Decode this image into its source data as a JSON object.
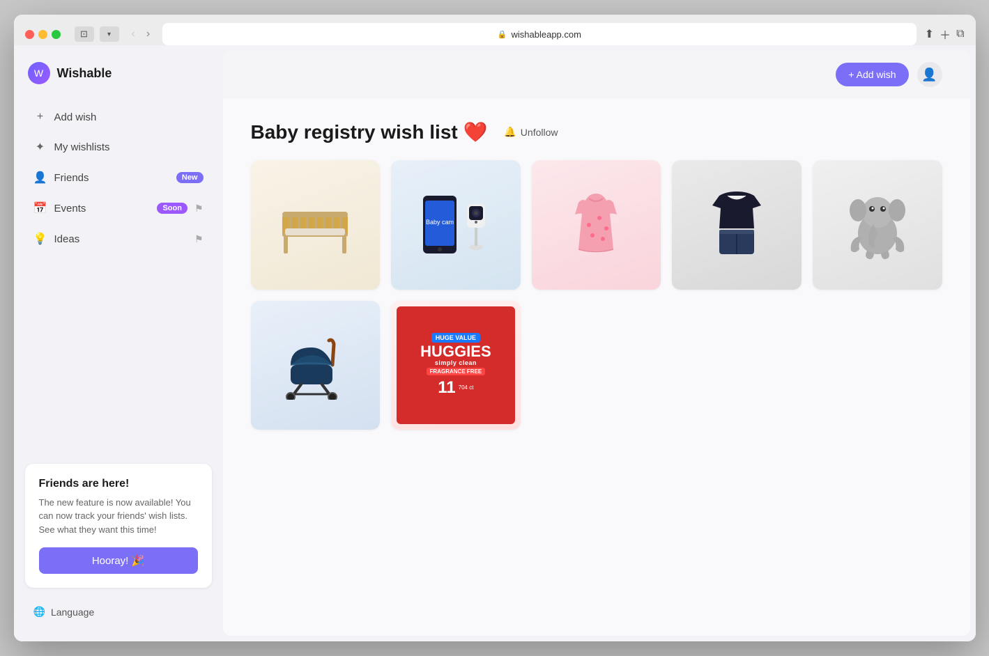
{
  "browser": {
    "url": "wishableapp.com",
    "tab_icon": "🔒"
  },
  "sidebar": {
    "logo_text": "Wishable",
    "nav_items": [
      {
        "id": "add-wish",
        "icon": "+",
        "label": "Add wish",
        "badge": null,
        "pinned": false
      },
      {
        "id": "my-wishlists",
        "icon": "✦",
        "label": "My wishlists",
        "badge": null,
        "pinned": false
      },
      {
        "id": "friends",
        "icon": "👤",
        "label": "Friends",
        "badge": "New",
        "badge_type": "new",
        "pinned": false
      },
      {
        "id": "events",
        "icon": "📅",
        "label": "Events",
        "badge": "Soon",
        "badge_type": "soon",
        "pinned": true
      },
      {
        "id": "ideas",
        "icon": "💡",
        "label": "Ideas",
        "badge": null,
        "pinned": true
      }
    ],
    "friends_card": {
      "title": "Friends are here!",
      "description": "The new feature is now available! You can now track your friends' wish lists. See what they want this time!",
      "button_label": "Hooray! 🎉"
    },
    "language_label": "Language"
  },
  "header": {
    "add_wish_label": "+ Add wish",
    "user_icon": "👤"
  },
  "main": {
    "page_title": "Baby registry wish list ❤️",
    "unfollow_label": "Unfollow",
    "products": [
      {
        "id": "crib",
        "emoji": "🛏️",
        "name": "Baby Crib",
        "color_from": "#f9f3e8",
        "color_to": "#f0e8d4"
      },
      {
        "id": "monitor",
        "emoji": "📱",
        "name": "Baby Monitor",
        "color_from": "#e8f0f9",
        "color_to": "#d4e4f0"
      },
      {
        "id": "dress",
        "emoji": "👗",
        "name": "Baby Dress",
        "color_from": "#fce8ec",
        "color_to": "#f9d4db"
      },
      {
        "id": "outfit",
        "emoji": "👕",
        "name": "Baby Outfit",
        "color_from": "#e8ecf9",
        "color_to": "#d4dbf0"
      },
      {
        "id": "elephant",
        "emoji": "🐘",
        "name": "Elephant Plush",
        "color_from": "#f2f2f2",
        "color_to": "#e5e5e5"
      },
      {
        "id": "stroller",
        "emoji": "🛺",
        "name": "Baby Stroller",
        "color_from": "#e8f0f9",
        "color_to": "#d4e0f0"
      }
    ],
    "huggies": {
      "brand": "HUGGIES",
      "type": "simply clean",
      "tagline": "FRAGRANCE FREE",
      "huge_value": "HUGE VALUE",
      "count": "11",
      "total": "704"
    }
  }
}
